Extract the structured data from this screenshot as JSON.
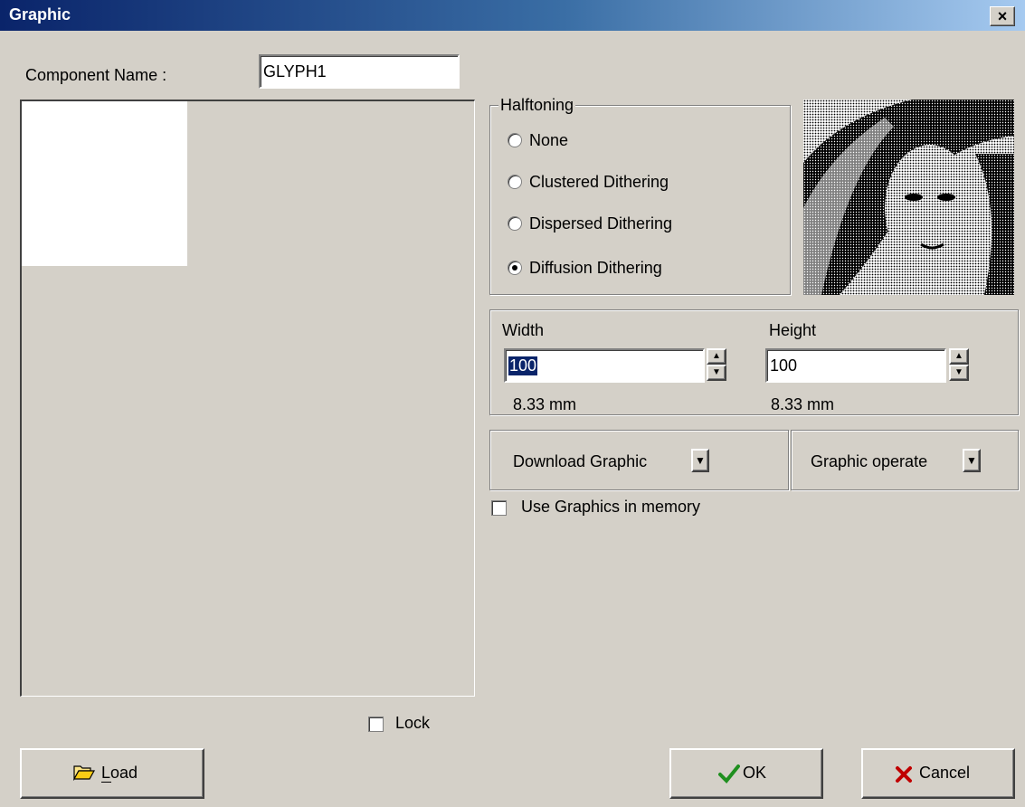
{
  "window": {
    "title": "Graphic",
    "close_label": "×"
  },
  "component_name": {
    "label": "Component Name :",
    "value": "GLYPH1"
  },
  "halftoning": {
    "legend": "Halftoning",
    "options": [
      "None",
      "Clustered Dithering",
      "Dispersed Dithering",
      "Diffusion Dithering"
    ],
    "selected": "Diffusion Dithering"
  },
  "size": {
    "width_label": "Width",
    "width_value": "100",
    "width_mm": "8.33 mm",
    "height_label": "Height",
    "height_value": "100",
    "height_mm": "8.33 mm"
  },
  "buttons": {
    "download_graphic": "Download Graphic",
    "graphic_operate": "Graphic operate",
    "load": "Load",
    "ok": "OK",
    "cancel": "Cancel"
  },
  "use_graphics_memory": {
    "label": "Use Graphics in memory",
    "checked": false
  },
  "lock": {
    "label": "Lock",
    "checked": false
  },
  "colors": {
    "title_start": "#0a246a",
    "title_end": "#a6caf0",
    "face": "#d4d0c8",
    "selection": "#0a246a"
  }
}
